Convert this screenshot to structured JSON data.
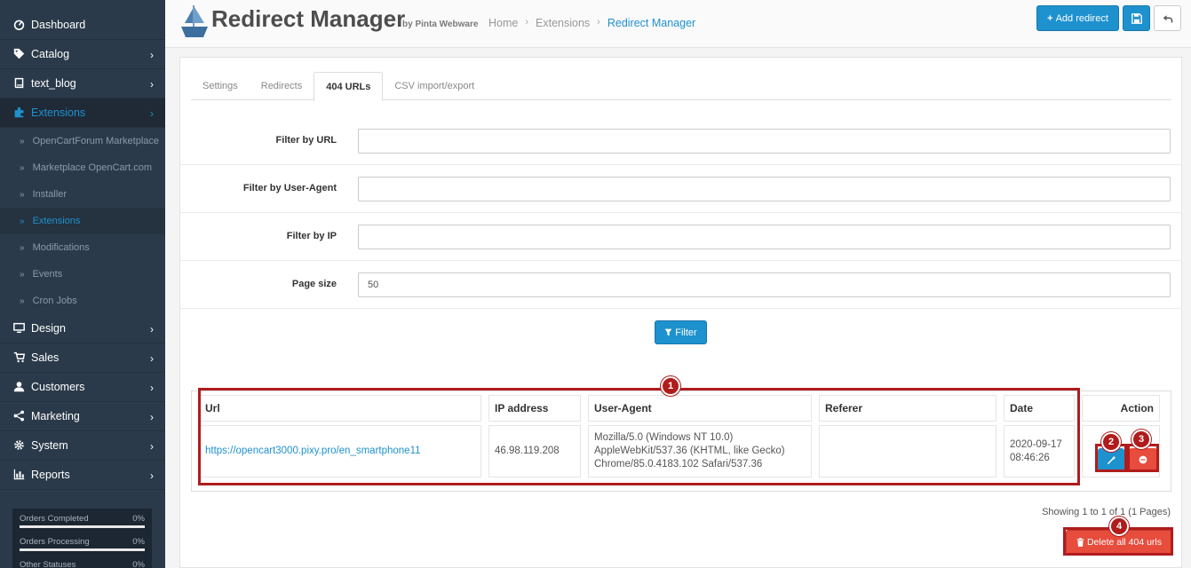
{
  "sidebar": {
    "items": [
      {
        "label": "Dashboard",
        "icon": "dashboard-icon",
        "has_chevron": false
      },
      {
        "label": "Catalog",
        "icon": "tag-icon",
        "has_chevron": true
      },
      {
        "label": "text_blog",
        "icon": "book-icon",
        "has_chevron": true
      },
      {
        "label": "Extensions",
        "icon": "puzzle-icon",
        "has_chevron": true,
        "active": true
      },
      {
        "label": "Design",
        "icon": "monitor-icon",
        "has_chevron": true
      },
      {
        "label": "Sales",
        "icon": "cart-icon",
        "has_chevron": true
      },
      {
        "label": "Customers",
        "icon": "user-icon",
        "has_chevron": true
      },
      {
        "label": "Marketing",
        "icon": "share-icon",
        "has_chevron": true
      },
      {
        "label": "System",
        "icon": "gear-icon",
        "has_chevron": true
      },
      {
        "label": "Reports",
        "icon": "bar-chart-icon",
        "has_chevron": true
      }
    ],
    "subitems": [
      {
        "label": "OpenCartForum Marketplace"
      },
      {
        "label": "Marketplace OpenCart.com"
      },
      {
        "label": "Installer"
      },
      {
        "label": "Extensions",
        "active": true
      },
      {
        "label": "Modifications"
      },
      {
        "label": "Events"
      },
      {
        "label": "Cron Jobs"
      }
    ],
    "stats": [
      {
        "label": "Orders Completed",
        "value": "0%",
        "progress": 0
      },
      {
        "label": "Orders Processing",
        "value": "0%",
        "progress": 0
      },
      {
        "label": "Other Statuses",
        "value": "0%",
        "progress": 0
      }
    ]
  },
  "header": {
    "title": "Redirect Manager",
    "by": "by Pinta Webware",
    "breadcrumbs": [
      "Home",
      "Extensions",
      "Redirect Manager"
    ],
    "add_label": "Add redirect"
  },
  "tabs": [
    "Settings",
    "Redirects",
    "404 URLs",
    "CSV import/export"
  ],
  "active_tab": "404 URLs",
  "filters": {
    "url_label": "Filter by URL",
    "url_value": "",
    "ua_label": "Filter by User-Agent",
    "ua_value": "",
    "ip_label": "Filter by IP",
    "ip_value": "",
    "pagesize_label": "Page size",
    "pagesize_value": "50",
    "filter_button": "Filter"
  },
  "table": {
    "headers": {
      "url": "Url",
      "ip": "IP address",
      "ua": "User-Agent",
      "referer": "Referer",
      "date": "Date",
      "action": "Action"
    },
    "rows": [
      {
        "url": "https://opencart3000.pixy.pro/en_smartphone11",
        "ip": "46.98.119.208",
        "ua_line1": "Mozilla/5.0 (Windows NT 10.0)",
        "ua_line2": "AppleWebKit/537.36 (KHTML, like Gecko)",
        "ua_line3": "Chrome/85.0.4183.102 Safari/537.36",
        "referer": "",
        "date_line1": "2020-09-17",
        "date_line2": "08:46:26"
      }
    ]
  },
  "pagination": {
    "text": "Showing 1 to 1 of 1 (1 Pages)"
  },
  "delete_all_label": "Delete all 404 urls",
  "annotations": [
    "1",
    "2",
    "3",
    "4"
  ],
  "colors": {
    "primary": "#1e91cf",
    "danger": "#e74c3c",
    "annotation": "#b01c1c",
    "sidebar_bg": "#2b3a4a"
  }
}
